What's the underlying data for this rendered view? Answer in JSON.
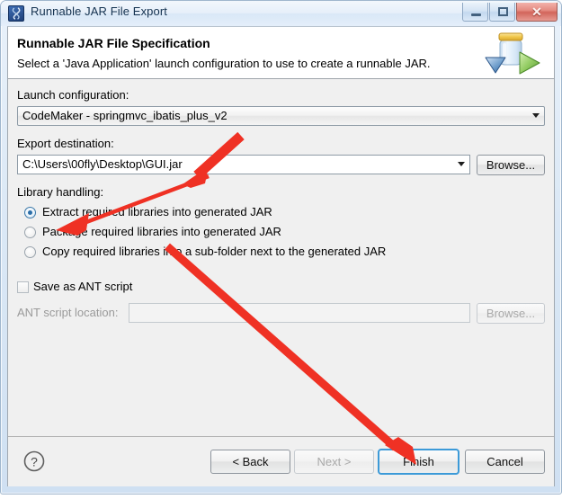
{
  "window": {
    "title": "Runnable JAR File Export",
    "icon": "jar-export-icon",
    "buttons": {
      "minimize": "minimize-button",
      "maximize": "maximize-button",
      "close_glyph": "✕"
    }
  },
  "banner": {
    "title": "Runnable JAR File Specification",
    "subtitle": "Select a 'Java Application' launch configuration to use to create a runnable JAR.",
    "icon": "runnable-jar-banner-icon"
  },
  "form": {
    "launch_configuration": {
      "label": "Launch configuration:",
      "value": "CodeMaker - springmvc_ibatis_plus_v2"
    },
    "export_destination": {
      "label": "Export destination:",
      "value": "C:\\Users\\00fly\\Desktop\\GUI.jar",
      "browse_label": "Browse..."
    },
    "library_handling": {
      "label": "Library handling:",
      "options": [
        {
          "label": "Extract required libraries into generated JAR",
          "selected": true
        },
        {
          "label": "Package required libraries into generated JAR",
          "selected": false
        },
        {
          "label": "Copy required libraries into a sub-folder next to the generated JAR",
          "selected": false
        }
      ]
    },
    "ant_script": {
      "checkbox_label": "Save as ANT script",
      "checked": false,
      "location_label": "ANT script location:",
      "location_value": "",
      "browse_label": "Browse...",
      "enabled": false
    }
  },
  "footer": {
    "help": "?",
    "back": "< Back",
    "next": "Next >",
    "finish": "Finish",
    "cancel": "Cancel",
    "next_enabled": false,
    "finish_default": true
  },
  "annotations": {
    "arrow_to_destination": "red-arrow-export-destination",
    "arrow_to_extract_option": "red-arrow-extract-libraries",
    "arrow_to_finish": "red-arrow-finish-button",
    "color": "#ef3124"
  },
  "colors": {
    "accent": "#3c9ad8",
    "annotation_red": "#ef3124",
    "dialog_bg": "#f0f0f0",
    "banner_bg": "#ffffff"
  }
}
